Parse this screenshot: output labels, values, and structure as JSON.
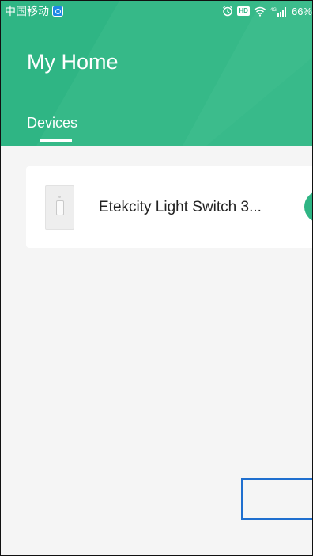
{
  "status_bar": {
    "carrier": "中国移动",
    "network": "4G",
    "battery": "66%"
  },
  "header": {
    "title": "My Home",
    "tabs": [
      {
        "label": "Devices",
        "active": true
      }
    ],
    "color": "#2fb584"
  },
  "devices": [
    {
      "name": "Etekcity Light Switch 3..."
    }
  ],
  "icons": {
    "carrier_app": "blue-app-icon",
    "alarm": "alarm-icon",
    "hd": "hd-icon",
    "wifi": "wifi-icon",
    "signal": "signal-icon",
    "device": "light-switch-icon",
    "power": "power-button"
  }
}
